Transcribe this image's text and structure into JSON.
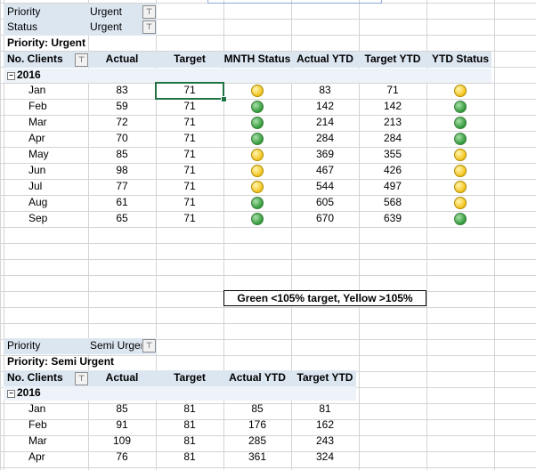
{
  "pivot1": {
    "filters": [
      {
        "label": "Priority",
        "value": "Urgent"
      },
      {
        "label": "Status",
        "value": "Urgent"
      }
    ],
    "title": "Priority: Urgent",
    "headers": [
      "No. Clients",
      "Actual",
      "Target",
      "MNTH Status",
      "Actual YTD",
      "Target YTD",
      "YTD Status"
    ],
    "year": "2016",
    "rows": [
      {
        "month": "Jan",
        "actual": "83",
        "target": "71",
        "mnth": "yellow",
        "actual_ytd": "83",
        "target_ytd": "71",
        "ytd": "yellow"
      },
      {
        "month": "Feb",
        "actual": "59",
        "target": "71",
        "mnth": "green",
        "actual_ytd": "142",
        "target_ytd": "142",
        "ytd": "green"
      },
      {
        "month": "Mar",
        "actual": "72",
        "target": "71",
        "mnth": "green",
        "actual_ytd": "214",
        "target_ytd": "213",
        "ytd": "green"
      },
      {
        "month": "Apr",
        "actual": "70",
        "target": "71",
        "mnth": "green",
        "actual_ytd": "284",
        "target_ytd": "284",
        "ytd": "green"
      },
      {
        "month": "May",
        "actual": "85",
        "target": "71",
        "mnth": "yellow",
        "actual_ytd": "369",
        "target_ytd": "355",
        "ytd": "yellow"
      },
      {
        "month": "Jun",
        "actual": "98",
        "target": "71",
        "mnth": "yellow",
        "actual_ytd": "467",
        "target_ytd": "426",
        "ytd": "yellow"
      },
      {
        "month": "Jul",
        "actual": "77",
        "target": "71",
        "mnth": "yellow",
        "actual_ytd": "544",
        "target_ytd": "497",
        "ytd": "yellow"
      },
      {
        "month": "Aug",
        "actual": "61",
        "target": "71",
        "mnth": "green",
        "actual_ytd": "605",
        "target_ytd": "568",
        "ytd": "yellow"
      },
      {
        "month": "Sep",
        "actual": "65",
        "target": "71",
        "mnth": "green",
        "actual_ytd": "670",
        "target_ytd": "639",
        "ytd": "green"
      }
    ]
  },
  "note": "Green <105% target, Yellow >105%",
  "pivot2": {
    "filter": {
      "label": "Priority",
      "value": "Semi Urger"
    },
    "title": "Priority: Semi Urgent",
    "headers": [
      "No. Clients",
      "Actual",
      "Target",
      "Actual YTD",
      "Target YTD"
    ],
    "year": "2016",
    "rows": [
      {
        "month": "Jan",
        "actual": "85",
        "target": "81",
        "actual_ytd": "85",
        "target_ytd": "81"
      },
      {
        "month": "Feb",
        "actual": "91",
        "target": "81",
        "actual_ytd": "176",
        "target_ytd": "162"
      },
      {
        "month": "Mar",
        "actual": "109",
        "target": "81",
        "actual_ytd": "285",
        "target_ytd": "243"
      },
      {
        "month": "Apr",
        "actual": "76",
        "target": "81",
        "actual_ytd": "361",
        "target_ytd": "324"
      }
    ]
  },
  "colors": {
    "green": "#2f9a3a",
    "yellow": "#f2c21b",
    "header_band": "#dce6f1",
    "selection": "#217346"
  },
  "icons": {
    "filter": "filter-icon",
    "collapse": "minus-collapse-icon"
  }
}
